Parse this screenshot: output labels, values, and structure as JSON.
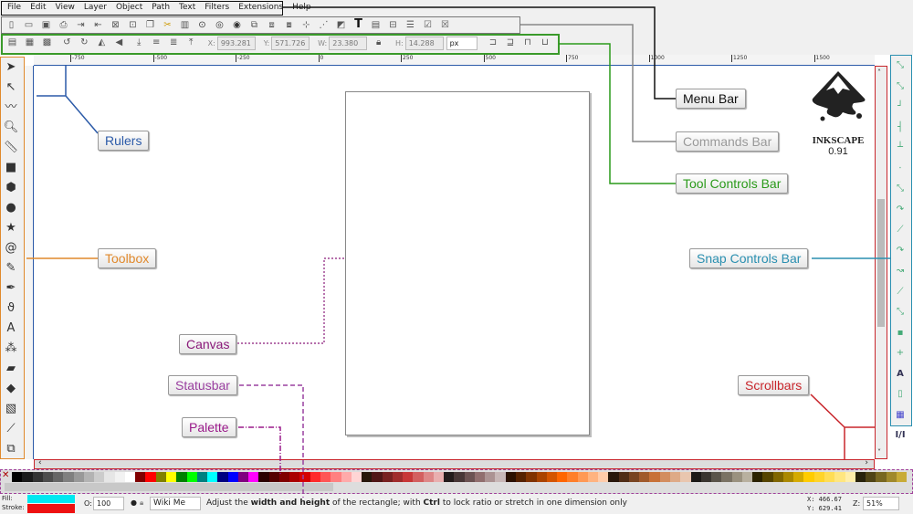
{
  "menu": [
    "File",
    "Edit",
    "View",
    "Layer",
    "Object",
    "Path",
    "Text",
    "Filters",
    "Extensions",
    "Help"
  ],
  "commands_icons": [
    "new-icon",
    "open-icon",
    "save-icon",
    "print-icon",
    "import-icon",
    "export-icon",
    "undo-icon",
    "redo-icon",
    "copy-icon",
    "cut-icon",
    "paste-icon",
    "zoom-selection-icon",
    "zoom-drawing-icon",
    "zoom-page-icon",
    "duplicate-icon",
    "clone-icon",
    "unlink-clone-icon",
    "group-icon",
    "ungroup-icon",
    "fill-stroke-icon",
    "text-icon",
    "layers-icon",
    "xml-editor-icon",
    "align-icon",
    "preferences-icon",
    "document-properties-icon"
  ],
  "controls": {
    "x_label": "X:",
    "x": "993.281",
    "y_label": "Y:",
    "y": "571.726",
    "w_label": "W:",
    "w": "23.380",
    "h_label": "H:",
    "h": "14.288",
    "unit": "px"
  },
  "ruler_ticks": [
    "-750",
    "-500",
    "-250",
    "0",
    "250",
    "500",
    "750",
    "1000",
    "1250",
    "1500"
  ],
  "tools": [
    "selector-icon",
    "node-icon",
    "tweak-icon",
    "zoom-icon",
    "measure-icon",
    "rectangle-icon",
    "3d-box-icon",
    "ellipse-icon",
    "star-icon",
    "spiral-icon",
    "pencil-icon",
    "pen-icon",
    "calligraphy-icon",
    "text-tool-icon",
    "spray-icon",
    "eraser-icon",
    "paint-bucket-icon",
    "gradient-icon",
    "dropper-icon",
    "connector-icon"
  ],
  "logo": {
    "name": "INKSCAPE",
    "version": "0.91"
  },
  "callouts": {
    "menu_bar": "Menu Bar",
    "commands_bar": "Commands Bar",
    "tool_controls_bar": "Tool Controls Bar",
    "rulers": "Rulers",
    "toolbox": "Toolbox",
    "canvas": "Canvas",
    "statusbar": "Statusbar",
    "palette": "Palette",
    "snap_controls_bar": "Snap Controls Bar",
    "scrollbars": "Scrollbars"
  },
  "callout_colors": {
    "menu_bar": "#111111",
    "commands_bar": "#888888",
    "tool_controls_bar": "#2a9a1a",
    "rulers": "#2b5aa8",
    "toolbox": "#e0892c",
    "canvas": "#8a1a7a",
    "statusbar": "#9a40a0",
    "palette": "#9a1a8a",
    "snap_controls_bar": "#2a8fb0",
    "scrollbars": "#c8262c"
  },
  "palette_colors": [
    "#000",
    "#1a1a1a",
    "#333",
    "#4d4d4d",
    "#666",
    "#808080",
    "#999",
    "#b3b3b3",
    "#ccc",
    "#e6e6e6",
    "#f2f2f2",
    "#fff",
    "#800000",
    "#ff0000",
    "#808000",
    "#ffff00",
    "#008000",
    "#00ff00",
    "#008080",
    "#00ffff",
    "#000080",
    "#0000ff",
    "#800080",
    "#ff00ff",
    "#2b0000",
    "#550000",
    "#800000",
    "#aa0000",
    "#d40000",
    "#ff2a2a",
    "#ff5555",
    "#ff8080",
    "#ffaaaa",
    "#ffd5d5",
    "#28170b",
    "#501616",
    "#782121",
    "#a02c2c",
    "#c83737",
    "#d35f5f",
    "#de8787",
    "#e9afaf",
    "#241c1c",
    "#483737",
    "#6c5353",
    "#916f6f",
    "#ac9393",
    "#c8b7b7",
    "#2b1100",
    "#552200",
    "#803300",
    "#aa4400",
    "#d45500",
    "#ff6600",
    "#ff7f2a",
    "#ff9955",
    "#ffb380",
    "#ffccaa",
    "#28170b",
    "#502d16",
    "#784421",
    "#a05a2c",
    "#c87137",
    "#d38d5f",
    "#deaa87",
    "#e9c6af",
    "#1c1a17",
    "#3a3630",
    "#5a544a",
    "#7a7264",
    "#9a917f",
    "#b8b09f",
    "#2b2200",
    "#554400",
    "#806600",
    "#aa8800",
    "#d4aa00",
    "#ffcc00",
    "#ffd42a",
    "#ffdd55",
    "#ffe680",
    "#ffeeaa",
    "#28220b",
    "#504416",
    "#786721",
    "#a0892c",
    "#c8ab37"
  ],
  "status": {
    "fill_label": "Fill:",
    "stroke_label": "Stroke:",
    "fill_color": "#00e8f0",
    "stroke_color": "#ee1111",
    "opacity_label": "O:",
    "opacity": "100",
    "layer": "Wiki Me",
    "message_pre": "Adjust the ",
    "message_b1": "width and height",
    "message_mid": " of the rectangle; with ",
    "message_b2": "Ctrl",
    "message_post": " to lock ratio or stretch in one dimension only",
    "cx_label": "X:",
    "cx": "466.67",
    "cy_label": "Y:",
    "cy": "629.41",
    "zoom_label": "Z:",
    "zoom": "51%"
  }
}
